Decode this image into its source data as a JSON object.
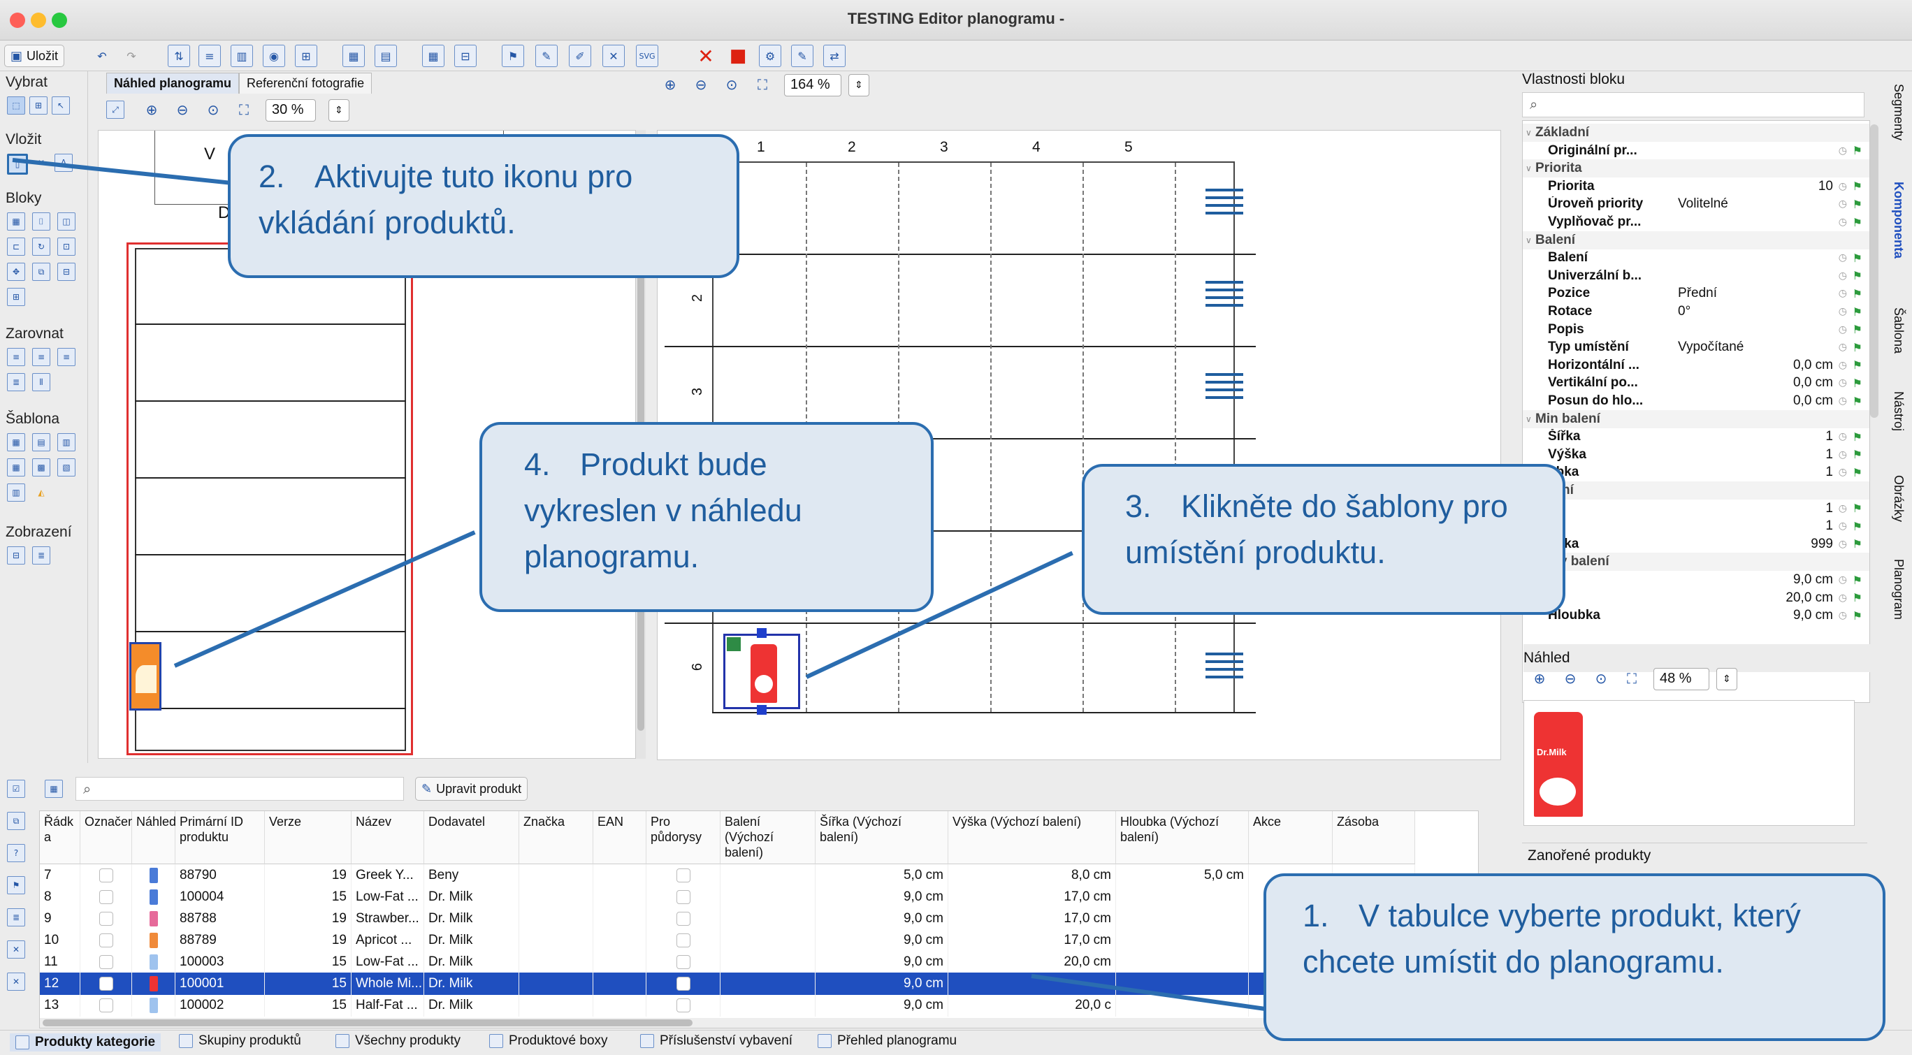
{
  "window": {
    "title": "TESTING Editor planogramu -"
  },
  "toolbar": {
    "save_label": "Uložit"
  },
  "left": {
    "groups": [
      "Vybrat",
      "Vložit",
      "Bloky",
      "Zarovnat",
      "Šablona",
      "Zobrazení"
    ]
  },
  "preview": {
    "tabs": [
      "Náhled planogramu",
      "Referenční fotografie"
    ],
    "zoom": "30 %",
    "shelf_text_top": "V",
    "shelf_text_mid": "D"
  },
  "editor": {
    "zoom": "164 %",
    "columns": [
      "1",
      "2",
      "3",
      "4",
      "5"
    ],
    "rows": [
      "2",
      "3",
      "6"
    ]
  },
  "callouts": {
    "c2": {
      "num": "2.",
      "text": "Aktivujte tuto ikonu pro vkládání produktů."
    },
    "c4": {
      "num": "4.",
      "text": "Produkt bude vykreslen v náhledu planogramu."
    },
    "c3": {
      "num": "3.",
      "text": "Klikněte do šablony pro umístění produktu."
    },
    "c1": {
      "num": "1.",
      "text": "V tabulce vyberte produkt, který chcete umístit do planogramu."
    }
  },
  "properties": {
    "title": "Vlastnosti bloku",
    "rows": [
      {
        "k": "Základní",
        "hdr": true
      },
      {
        "k": "Originální pr...",
        "hdr": false,
        "v": ""
      },
      {
        "k": "Priorita",
        "hdr": true
      },
      {
        "k": "Priorita",
        "v": "",
        "vr": "10"
      },
      {
        "k": "Úroveň priority",
        "v": "Volitelné",
        "vr": ""
      },
      {
        "k": "Vyplňovač pr...",
        "v": "",
        "vr": ""
      },
      {
        "k": "Balení",
        "hdr": true
      },
      {
        "k": "Balení",
        "v": "",
        "vr": ""
      },
      {
        "k": "Univerzální b...",
        "v": "",
        "vr": ""
      },
      {
        "k": "Pozice",
        "v": "Přední",
        "vr": ""
      },
      {
        "k": "Rotace",
        "v": "0°",
        "vr": ""
      },
      {
        "k": "Popis",
        "v": "",
        "vr": ""
      },
      {
        "k": "Typ umístění",
        "v": "Vypočítané",
        "vr": ""
      },
      {
        "k": "Horizontální ...",
        "v": "",
        "vr": "0,0 cm"
      },
      {
        "k": "Vertikální po...",
        "v": "",
        "vr": "0,0 cm"
      },
      {
        "k": "Posun do hlo...",
        "v": "",
        "vr": "0,0 cm"
      },
      {
        "k": "Min balení",
        "hdr": true
      },
      {
        "k": "Šířka",
        "v": "",
        "vr": "1"
      },
      {
        "k": "Výška",
        "v": "",
        "vr": "1"
      },
      {
        "k": "ubka",
        "v": "",
        "vr": "1"
      },
      {
        "k": "balení",
        "hdr": true
      },
      {
        "k": "a",
        "v": "",
        "vr": "1"
      },
      {
        "k": "ka",
        "v": "",
        "vr": "1"
      },
      {
        "k": "ubka",
        "v": "",
        "vr": "999"
      },
      {
        "k": "měry balení",
        "hdr": true
      },
      {
        "k": "a",
        "v": "",
        "vr": "9,0 cm"
      },
      {
        "k": "ka",
        "v": "",
        "vr": "20,0 cm"
      },
      {
        "k": "Hloubka",
        "v": "",
        "vr": "9,0 cm"
      }
    ]
  },
  "nahled": {
    "title": "Náhled",
    "zoom": "48 %",
    "brand": "Dr.Milk"
  },
  "nested": {
    "title": "Zanořené produkty"
  },
  "grid": {
    "edit_button": "Upravit produkt",
    "headers": [
      "Řádk a",
      "Označené",
      "Náhled",
      "Primární ID produktu",
      "Verze",
      "Název",
      "Dodavatel",
      "Značka",
      "EAN",
      "Pro půdorysy",
      "Balení (Výchozí balení)",
      "Šířka (Výchozí balení)",
      "Výška (Výchozí balení)",
      "Hloubka (Výchozí balení)",
      "Akce",
      "Zásoba"
    ],
    "rows": [
      {
        "r": "7",
        "id": "88790",
        "ver": "19",
        "name": "Greek Y...",
        "sup": "Beny",
        "w": "5,0 cm",
        "h": "8,0 cm",
        "d": "5,0 cm",
        "sel": false
      },
      {
        "r": "8",
        "id": "100004",
        "ver": "15",
        "name": "Low-Fat ...",
        "sup": "Dr. Milk",
        "w": "9,0 cm",
        "h": "17,0 cm",
        "d": "",
        "sel": false
      },
      {
        "r": "9",
        "id": "88788",
        "ver": "19",
        "name": "Strawber...",
        "sup": "Dr. Milk",
        "w": "9,0 cm",
        "h": "17,0 cm",
        "d": "",
        "sel": false
      },
      {
        "r": "10",
        "id": "88789",
        "ver": "19",
        "name": "Apricot ...",
        "sup": "Dr. Milk",
        "w": "9,0 cm",
        "h": "17,0 cm",
        "d": "",
        "sel": false
      },
      {
        "r": "11",
        "id": "100003",
        "ver": "15",
        "name": "Low-Fat ...",
        "sup": "Dr. Milk",
        "w": "9,0 cm",
        "h": "20,0 cm",
        "d": "",
        "sel": false
      },
      {
        "r": "12",
        "id": "100001",
        "ver": "15",
        "name": "Whole Mi...",
        "sup": "Dr. Milk",
        "w": "9,0 cm",
        "h": "",
        "d": "",
        "sel": true
      },
      {
        "r": "13",
        "id": "100002",
        "ver": "15",
        "name": "Half-Fat ...",
        "sup": "Dr. Milk",
        "w": "9,0 cm",
        "h": "20,0 c",
        "d": "",
        "sel": false
      }
    ]
  },
  "bottom_tabs": [
    "Produkty kategorie",
    "Skupiny produktů",
    "Všechny produkty",
    "Produktové boxy",
    "Příslušenství vybavení",
    "Přehled planogramu"
  ],
  "side_tabs": [
    "Segmenty",
    "Komponenta",
    "Šablona",
    "Nástroj",
    "Obrázky",
    "Planogram"
  ]
}
